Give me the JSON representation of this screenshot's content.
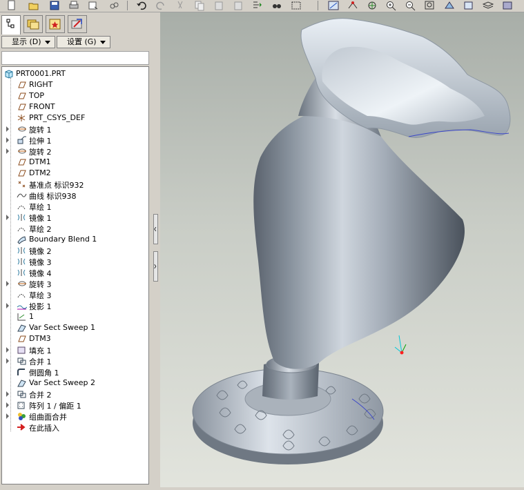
{
  "toolbar": {
    "buttons": [
      "new-icon",
      "open-icon",
      "save-icon",
      "print-icon",
      "send-icon",
      "link-icon",
      "undo-icon",
      "redo-icon",
      "cut-icon",
      "copy-icon",
      "paste-icon",
      "paste-special-icon",
      "regenerate-icon",
      "find-icon",
      "select-box-icon",
      "repaint-icon",
      "spin-center-icon",
      "orient-icon",
      "zoom-in-icon",
      "zoom-out-icon",
      "refit-icon",
      "view-manager-icon",
      "saved-views-icon",
      "layers-icon",
      "display-style-icon"
    ]
  },
  "panel": {
    "tabs": [
      "model-tree-tab",
      "folder-browser-tab",
      "favorites-tab",
      "connections-tab"
    ],
    "show_button": "显示 (D)",
    "settings_button": "设置 (G)"
  },
  "tree": {
    "root": "PRT0001.PRT",
    "items": [
      {
        "label": "RIGHT",
        "icon": "datum-plane-icon",
        "expandable": false
      },
      {
        "label": "TOP",
        "icon": "datum-plane-icon",
        "expandable": false
      },
      {
        "label": "FRONT",
        "icon": "datum-plane-icon",
        "expandable": false
      },
      {
        "label": "PRT_CSYS_DEF",
        "icon": "csys-icon",
        "expandable": false
      },
      {
        "label": "旋转 1",
        "icon": "revolve-icon",
        "expandable": true
      },
      {
        "label": "拉伸 1",
        "icon": "extrude-icon",
        "expandable": true
      },
      {
        "label": "旋转 2",
        "icon": "revolve-icon",
        "expandable": true
      },
      {
        "label": "DTM1",
        "icon": "datum-plane-icon",
        "expandable": false
      },
      {
        "label": "DTM2",
        "icon": "datum-plane-icon",
        "expandable": false
      },
      {
        "label": "基准点 标识932",
        "icon": "datum-point-icon",
        "expandable": false
      },
      {
        "label": "曲线 标识938",
        "icon": "curve-icon",
        "expandable": false
      },
      {
        "label": "草绘 1",
        "icon": "sketch-icon",
        "expandable": false
      },
      {
        "label": "镜像 1",
        "icon": "mirror-icon",
        "expandable": true
      },
      {
        "label": "草绘 2",
        "icon": "sketch-icon",
        "expandable": false
      },
      {
        "label": "Boundary Blend 1",
        "icon": "boundary-blend-icon",
        "expandable": false
      },
      {
        "label": "镜像 2",
        "icon": "mirror-icon",
        "expandable": false
      },
      {
        "label": "镜像 3",
        "icon": "mirror-icon",
        "expandable": false
      },
      {
        "label": "镜像 4",
        "icon": "mirror-icon",
        "expandable": false
      },
      {
        "label": "旋转 3",
        "icon": "revolve-icon",
        "expandable": true
      },
      {
        "label": "草绘 3",
        "icon": "sketch-icon",
        "expandable": false
      },
      {
        "label": "投影 1",
        "icon": "project-icon",
        "expandable": true
      },
      {
        "label": "1",
        "icon": "trajectory-icon",
        "expandable": false
      },
      {
        "label": "Var Sect Sweep 1",
        "icon": "sweep-icon",
        "expandable": false
      },
      {
        "label": "DTM3",
        "icon": "datum-plane-icon",
        "expandable": false
      },
      {
        "label": "填充 1",
        "icon": "fill-icon",
        "expandable": true
      },
      {
        "label": "合并 1",
        "icon": "merge-icon",
        "expandable": true
      },
      {
        "label": "倒圆角 1",
        "icon": "round-icon",
        "expandable": false
      },
      {
        "label": "Var Sect Sweep 2",
        "icon": "sweep-icon",
        "expandable": false
      },
      {
        "label": "合并 2",
        "icon": "merge-icon",
        "expandable": true
      },
      {
        "label": "阵列 1 / 偏距 1",
        "icon": "pattern-icon",
        "expandable": true
      },
      {
        "label": "组曲面合并",
        "icon": "group-icon",
        "expandable": true
      },
      {
        "label": "在此插入",
        "icon": "insert-here-icon",
        "expandable": false
      }
    ]
  },
  "colors": {
    "vase_light": "#eaf0f6",
    "vase_mid": "#9ea8b4",
    "vase_dark": "#4e5661",
    "datum_plane": "#8a4a1a",
    "insert_arrow": "#d42020",
    "csys_x": "#00a000",
    "csys_y": "#00c8d8",
    "csys_z": "#ff2020"
  }
}
